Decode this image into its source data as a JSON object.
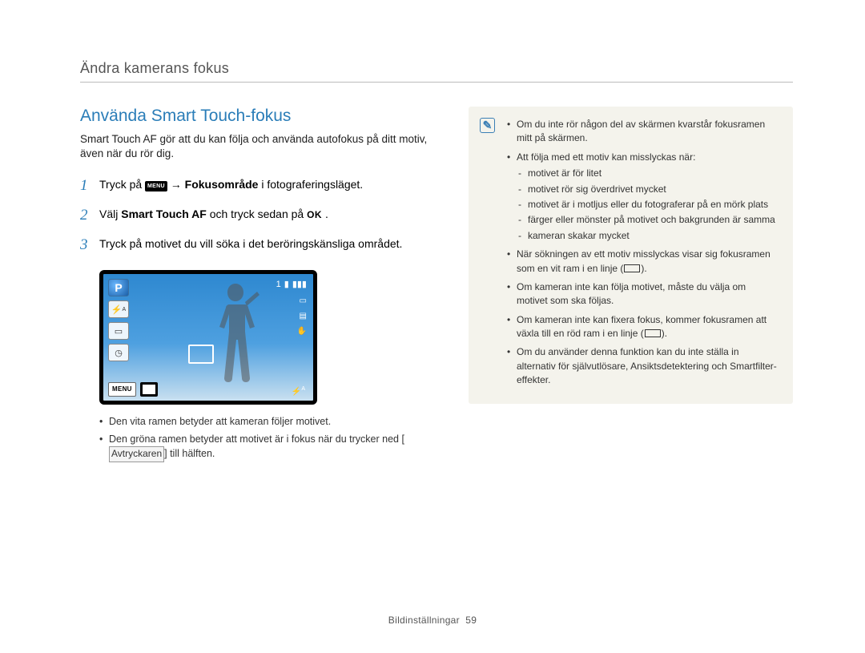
{
  "header": {
    "title": "Ändra kamerans fokus"
  },
  "section": {
    "heading": "Använda Smart Touch-fokus",
    "intro": "Smart Touch AF gör att du kan följa och använda autofokus på ditt motiv, även när du rör dig."
  },
  "steps": [
    {
      "num": "1",
      "prefix": "Tryck på ",
      "menu_label": "MENU",
      "arrow": " → ",
      "bold": "Fokusområde",
      "suffix": " i fotograferingsläget."
    },
    {
      "num": "2",
      "prefix": "Välj ",
      "bold": "Smart Touch AF",
      "mid": " och tryck sedan på ",
      "ok": "OK",
      "suffix": "."
    },
    {
      "num": "3",
      "text": "Tryck på motivet du vill söka i det beröringskänsliga området."
    }
  ],
  "screenshot": {
    "p_label": "P",
    "bottom_menu": "MENU",
    "top_right_count": "1",
    "flash_a": "A",
    "bottom_right": "A"
  },
  "sub_bullets": [
    "Den vita ramen betyder att kameran följer motivet.",
    {
      "pre": "Den gröna ramen betyder att motivet är i fokus när du trycker ned [",
      "box": "Avtryckaren",
      "post": "] till hälften."
    }
  ],
  "notes": [
    "Om du inte rör någon del av skärmen kvarstår fokusramen mitt på skärmen.",
    {
      "lead": "Att följa med ett motiv kan misslyckas när:",
      "items": [
        "motivet är för litet",
        "motivet rör sig överdrivet mycket",
        "motivet är i motljus eller du fotograferar på en mörk plats",
        "färger eller mönster på motivet och bakgrunden är samma",
        "kameran skakar mycket"
      ]
    },
    {
      "pre": "När sökningen av ett motiv misslyckas visar sig fokusramen som en vit ram i en linje (",
      "post": ")."
    },
    "Om kameran inte kan följa motivet, måste du välja om motivet som ska följas.",
    {
      "pre": "Om kameran inte kan fixera fokus, kommer fokusramen att växla till en röd ram i en linje (",
      "post": ")."
    },
    "Om du använder denna funktion kan du inte ställa in alternativ för självutlösare, Ansiktsdetektering och Smartfilter-effekter."
  ],
  "footer": {
    "section": "Bildinställningar",
    "page": "59"
  }
}
